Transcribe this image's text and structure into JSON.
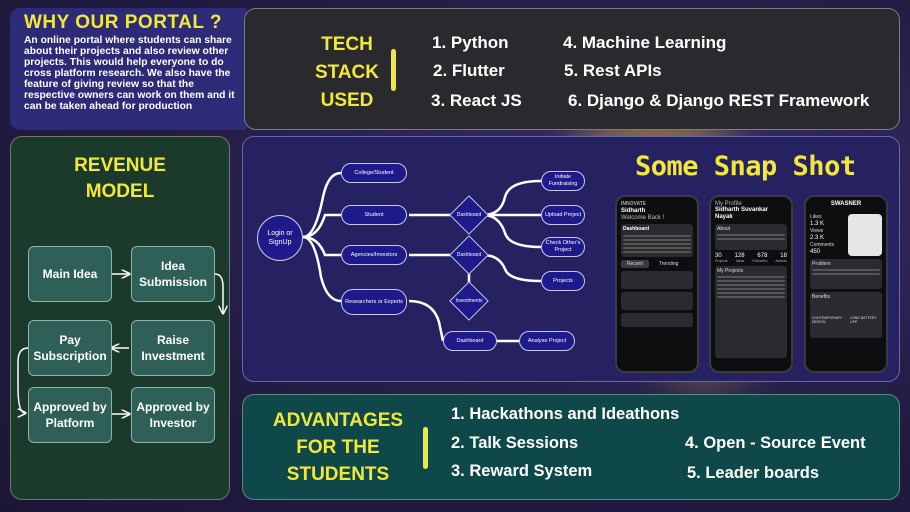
{
  "why": {
    "title": "WHY OUR PORTAL ?",
    "text": "An online portal where students can share about their projects and also review other projects. This would help everyone to do cross platform research. We also have the feature of giving review so that the respective owners can work on them and it can be taken ahead for production"
  },
  "tech_stack": {
    "title_l1": "TECH",
    "title_l2": "STACK",
    "title_l3": "USED",
    "items": [
      "1. Python",
      "2. Flutter",
      "3. React JS",
      "4. Machine Learning",
      "5. Rest APIs",
      "6. Django & Django REST Framework"
    ]
  },
  "revenue": {
    "title_l1": "REVENUE",
    "title_l2": "MODEL",
    "steps": [
      "Main Idea",
      "Idea Submission",
      "Raise Investment",
      "Pay Subscription",
      "Approved by Platform",
      "Approved by Investor"
    ]
  },
  "flowchart": {
    "login": "Login or SignUp",
    "roles": [
      "College/Student",
      "Student",
      "Agencies/Investors",
      "Researchers or Experts"
    ],
    "dashboards": [
      "Dashboard",
      "Dashboard",
      "Investments",
      "Dashboard"
    ],
    "actions": [
      "Initiate Fundraising",
      "Upload Project",
      "Check Other's Project",
      "Projects",
      "Analyse Project"
    ]
  },
  "snapshots": {
    "title": "Some Snap Shot",
    "phone1": {
      "brand": "INNOVATE",
      "user": "Sidharth",
      "greeting": "Welcome Back !",
      "section": "Dashboard",
      "tabs": [
        "Recent",
        "Trending"
      ]
    },
    "phone2": {
      "header": "My Profile",
      "user": "Sidharth Suvankar Nayak",
      "about": "About",
      "stats": [
        "30",
        "128",
        "678",
        "18"
      ],
      "stat_labels": [
        "Projects",
        "Ideas",
        "Followers",
        "Awards"
      ],
      "projects": "My Projects"
    },
    "phone3": {
      "name": "SWASNER",
      "likes_label": "Likes",
      "likes": "1.3 K",
      "views_label": "Views",
      "views": "2.3 K",
      "comments_label": "Comments",
      "comments": "450",
      "problem": "Problem",
      "benefits": "Benefits",
      "b1": "CONTEMPORARY DESIGN",
      "b2": "LONG BATTERY LIFE"
    }
  },
  "advantages": {
    "title_l1": "ADVANTAGES",
    "title_l2": "FOR THE",
    "title_l3": "STUDENTS",
    "items": [
      "1. Hackathons and Ideathons",
      "2. Talk Sessions",
      "3. Reward System",
      "4. Open - Source Event",
      "5. Leader boards"
    ]
  },
  "colors": {
    "accent": "#f1e83a",
    "why_bg": "#2d2a78",
    "revenue_bg": "#1b3a2b",
    "flow_bg": "#262262",
    "adv_bg": "#0f4848"
  }
}
